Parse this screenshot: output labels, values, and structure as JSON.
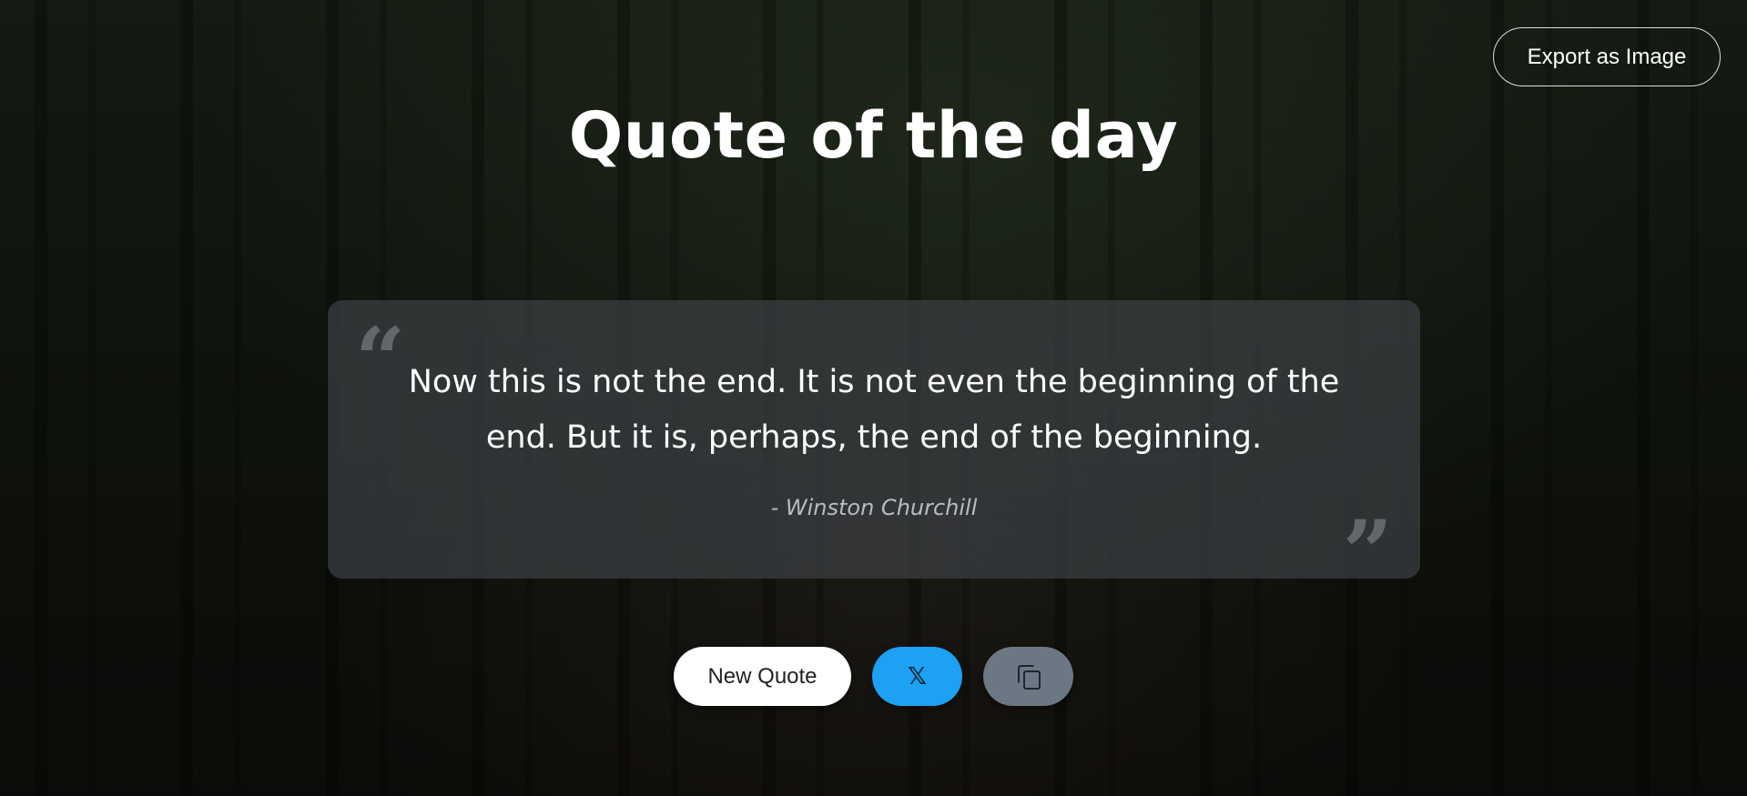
{
  "header": {
    "export_label": "Export as Image"
  },
  "page": {
    "title": "Quote of the day"
  },
  "quote": {
    "text": "Now this is not the end. It is not even the beginning of the end. But it is, perhaps, the end of the beginning.",
    "author": "- Winston Churchill",
    "open_mark": "“",
    "close_mark": "”"
  },
  "actions": {
    "new_quote_label": "New Quote",
    "share_x_label": "𝕏",
    "share_x_icon": "x-logo-icon",
    "copy_icon": "copy-icon"
  },
  "colors": {
    "twitter_blue": "#1da1f2",
    "copy_gray": "#6b7884",
    "card_bg": "#3c4044"
  }
}
